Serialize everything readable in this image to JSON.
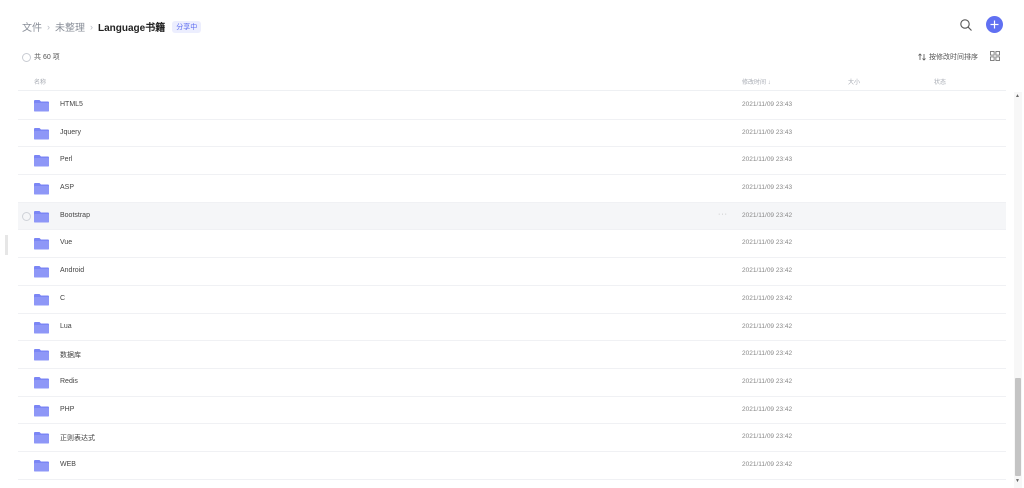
{
  "breadcrumb": {
    "items": [
      "文件",
      "未整理"
    ],
    "separator": "›",
    "current": "Language书籍",
    "badge": "分享中"
  },
  "header": {
    "search_icon": "search-icon",
    "add_icon": "plus-icon"
  },
  "toolbar": {
    "total": "共 60 项",
    "sort_label": "按修改时间排序",
    "view_icon": "grid-view-icon"
  },
  "columns": {
    "name": "名称",
    "modified": "修改时间 ↓",
    "size": "大小",
    "status": "状态"
  },
  "rows": [
    {
      "name": "HTML5",
      "modified": "2021/11/09 23:43"
    },
    {
      "name": "Jquery",
      "modified": "2021/11/09 23:43"
    },
    {
      "name": "Perl",
      "modified": "2021/11/09 23:43"
    },
    {
      "name": "ASP",
      "modified": "2021/11/09 23:43"
    },
    {
      "name": "Bootstrap",
      "modified": "2021/11/09 23:42"
    },
    {
      "name": "Vue",
      "modified": "2021/11/09 23:42"
    },
    {
      "name": "Android",
      "modified": "2021/11/09 23:42"
    },
    {
      "name": "C",
      "modified": "2021/11/09 23:42"
    },
    {
      "name": "Lua",
      "modified": "2021/11/09 23:42"
    },
    {
      "name": "数据库",
      "modified": "2021/11/09 23:42"
    },
    {
      "name": "Redis",
      "modified": "2021/11/09 23:42"
    },
    {
      "name": "PHP",
      "modified": "2021/11/09 23:42"
    },
    {
      "name": "正则表达式",
      "modified": "2021/11/09 23:42"
    },
    {
      "name": "WEB",
      "modified": "2021/11/09 23:42"
    },
    {
      "name": "",
      "modified": ""
    }
  ],
  "hover_row_more": "···",
  "colors": {
    "accent": "#6070f2",
    "folder": "#7b86f5",
    "badge_bg": "#eceefe"
  }
}
